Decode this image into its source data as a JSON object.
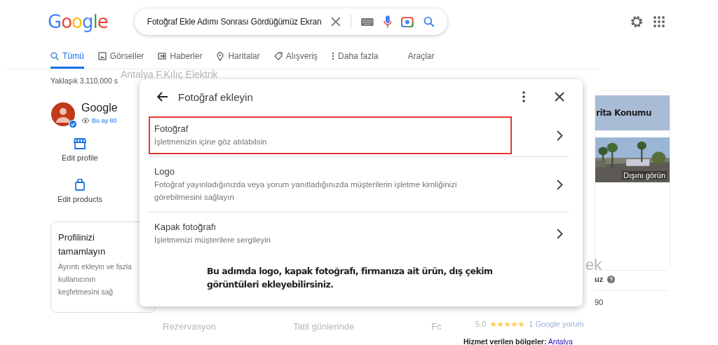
{
  "header": {
    "logo": "Google",
    "query": "Fotoğraf Ekle Adımı Sonrası Gördüğümüz Ekran"
  },
  "tabs": [
    {
      "label": "Tümü",
      "kind": "all",
      "selected": true
    },
    {
      "label": "Görseller",
      "kind": "images",
      "selected": false
    },
    {
      "label": "Haberler",
      "kind": "news",
      "selected": false
    },
    {
      "label": "Haritalar",
      "kind": "maps",
      "selected": false
    },
    {
      "label": "Alışveriş",
      "kind": "shopping",
      "selected": false
    },
    {
      "label": "Daha fazla",
      "kind": "more",
      "selected": false
    }
  ],
  "tools": "Araçlar",
  "faded_search": "Antalya F.Kılıç Elektrik",
  "result_count": "Yaklaşık 3.110.000 s",
  "profile": {
    "name": "Google",
    "views": "Bu ay 80",
    "verified": true
  },
  "actions": [
    {
      "label": "Edit profile",
      "kind": "store"
    },
    {
      "label": "Edit products",
      "kind": "bag"
    }
  ],
  "complete_card": {
    "title": "Profilinizi tamamlayın",
    "text": "Ayrıntı ekleyin ve fazla kullanıcının keşfetmesini sağ"
  },
  "faded_cards": [
    "Rezervasyon",
    "Tatil günlerinde",
    "Fc"
  ],
  "right_panel": {
    "map_label": "rita Konumu",
    "photo_label": "Dışını görün",
    "faded_title": "ek",
    "question": "uz",
    "number": "90",
    "rating": "5.0",
    "stars": 5,
    "reviews": "1 Google yorum",
    "areas_label": "Hizmet verilen bölgeler:",
    "areas_link": "Antalya"
  },
  "dialog": {
    "title": "Fotoğraf ekleyin",
    "options": [
      {
        "title": "Fotoğraf",
        "description": "İşletmenizin içine göz atılabilsin",
        "highlighted": true
      },
      {
        "title": "Logo",
        "description": "Fotoğraf yayınladığınızda veya yorum yanıtladığınızda müşterilerin işletme kimliğinizi görebilmesini sağlayın",
        "highlighted": false
      },
      {
        "title": "Kapak fotoğrafı",
        "description": "İşletmenizi müşterilere sergileyin",
        "highlighted": false
      }
    ],
    "note": "Bu adımda logo, kapak fotoğrafı, firmanıza ait ürün, dış çekim görüntüleri ekleyebilirsiniz."
  }
}
